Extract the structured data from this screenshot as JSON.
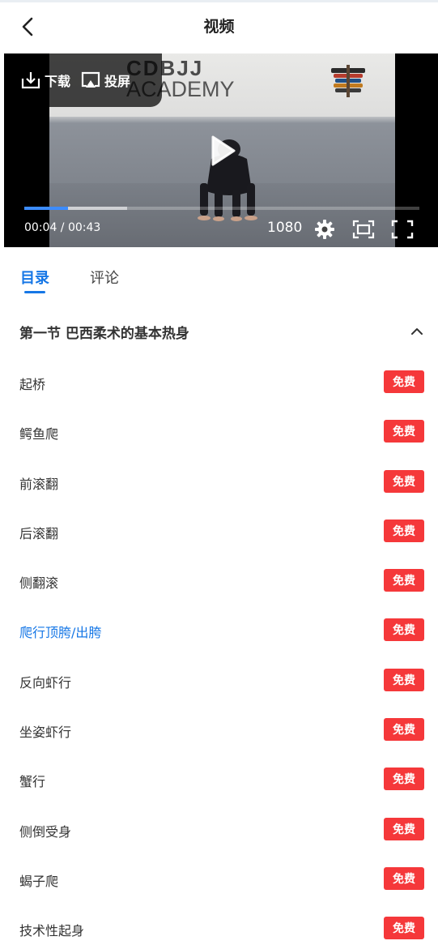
{
  "header": {
    "title": "视频",
    "back_icon": "chevron-left-icon"
  },
  "player": {
    "download_label": "下载",
    "cast_label": "投屏",
    "scene_logo_line1": "CDBJJ",
    "scene_logo_line2": "ACADEMY",
    "current_time": "00:04",
    "duration": "00:43",
    "time_text": "00:04 / 00:43",
    "quality": "1080",
    "progress_played": 0.11,
    "progress_buffered": 0.26,
    "accent": "#3c8cff"
  },
  "tabs": [
    {
      "label": "目录",
      "active": true
    },
    {
      "label": "评论",
      "active": false
    }
  ],
  "section": {
    "title": "第一节 巴西柔术的基本热身",
    "expanded": true
  },
  "lessons": [
    {
      "title": "起桥",
      "badge": "免费",
      "active": false
    },
    {
      "title": "鳄鱼爬",
      "badge": "免费",
      "active": false
    },
    {
      "title": "前滚翻",
      "badge": "免费",
      "active": false
    },
    {
      "title": "后滚翻",
      "badge": "免费",
      "active": false
    },
    {
      "title": "侧翻滚",
      "badge": "免费",
      "active": false
    },
    {
      "title": "爬行顶胯/出胯",
      "badge": "免费",
      "active": true
    },
    {
      "title": "反向虾行",
      "badge": "免费",
      "active": false
    },
    {
      "title": "坐姿虾行",
      "badge": "免费",
      "active": false
    },
    {
      "title": "蟹行",
      "badge": "免费",
      "active": false
    },
    {
      "title": "侧倒受身",
      "badge": "免费",
      "active": false
    },
    {
      "title": "蝎子爬",
      "badge": "免费",
      "active": false
    },
    {
      "title": "技术性起身",
      "badge": "免费",
      "active": false
    }
  ],
  "colors": {
    "primary": "#1677e6",
    "badge": "#f5383a",
    "text": "#333333"
  }
}
